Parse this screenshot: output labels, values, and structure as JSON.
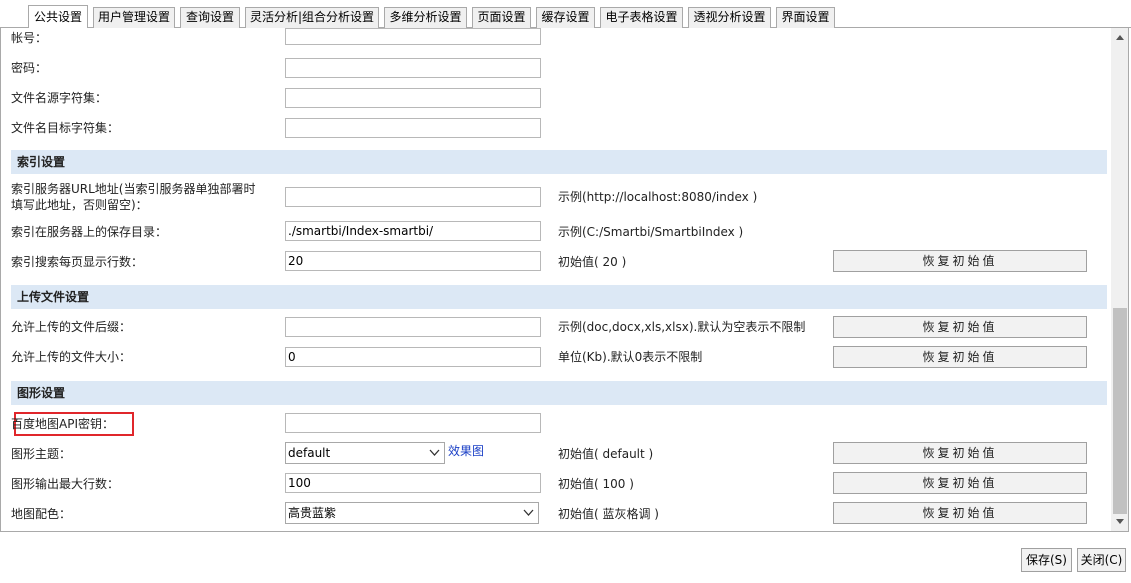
{
  "tabs": [
    "公共设置",
    "用户管理设置",
    "查询设置",
    "灵活分析|组合分析设置",
    "多维分析设置",
    "页面设置",
    "缓存设置",
    "电子表格设置",
    "透视分析设置",
    "界面设置"
  ],
  "fields": {
    "account": {
      "label": "帐号：",
      "value": ""
    },
    "password": {
      "label": "密码：",
      "value": ""
    },
    "filename_src": {
      "label": "文件名源字符集：",
      "value": ""
    },
    "filename_dst": {
      "label": "文件名目标字符集：",
      "value": ""
    }
  },
  "sections": {
    "index": "索引设置",
    "upload": "上传文件设置",
    "graph": "图形设置"
  },
  "index": {
    "url": {
      "label_line1": "索引服务器URL地址(当索引服务器单独部署时",
      "label_line2": "填写此地址，否则留空)：",
      "value": "",
      "hint": "示例(http://localhost:8080/index )"
    },
    "dir": {
      "label": "索引在服务器上的保存目录：",
      "value": "./smartbi/Index-smartbi/",
      "hint": "示例(C:/Smartbi/SmartbiIndex )"
    },
    "rows": {
      "label": "索引搜索每页显示行数：",
      "value": "20",
      "hint": "初始值( 20 )"
    }
  },
  "upload": {
    "ext": {
      "label": "允许上传的文件后缀：",
      "value": "",
      "hint": "示例(doc,docx,xls,xlsx).默认为空表示不限制"
    },
    "size": {
      "label": "允许上传的文件大小：",
      "value": "0",
      "hint": "单位(Kb).默认0表示不限制"
    }
  },
  "graph": {
    "baidu_key": {
      "label": "百度地图API密钥：",
      "value": ""
    },
    "theme": {
      "label": "图形主题：",
      "value": "default",
      "link": "效果图",
      "hint": "初始值( default )"
    },
    "max_rows": {
      "label": "图形输出最大行数：",
      "value": "100",
      "hint": "初始值( 100 )"
    },
    "map_color": {
      "label": "地图配色：",
      "value": "高贵蓝紫",
      "hint": "初始值( 蓝灰格调 )"
    }
  },
  "reset_label": "恢复初始值",
  "footer": {
    "save": "保存(S)",
    "close": "关闭(C)"
  },
  "colors": {
    "section_bg": "#dce8f5",
    "highlight": "#e0262b",
    "link": "#1a3fc6"
  }
}
